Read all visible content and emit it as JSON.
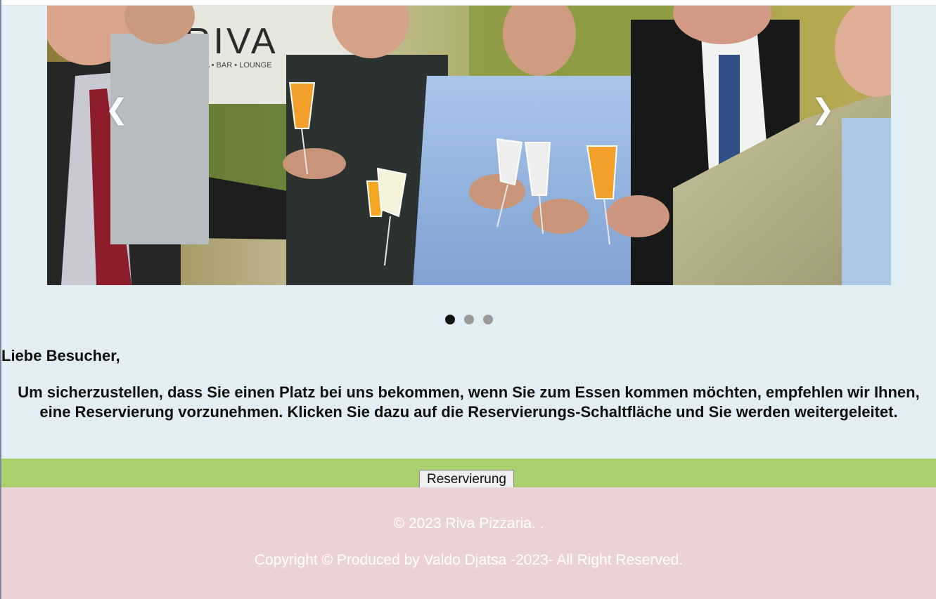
{
  "slideshow": {
    "prev_arrow": "❮",
    "next_arrow": "❯",
    "dots": [
      true,
      false,
      false
    ],
    "sign_text": "RIVA",
    "sign_subtext": "PIZZA • BAR • LOUNGE"
  },
  "content": {
    "greeting": "Liebe Besucher,",
    "intro": "Um sicherzustellen, dass Sie einen Platz bei uns bekommen, wenn Sie zum Essen kommen möchten, empfehlen wir Ihnen, eine Reservierung vorzunehmen. Klicken Sie dazu auf die Reservierungs-Schaltfläche und Sie werden weitergeleitet."
  },
  "reservation": {
    "button_label": "Reservierung"
  },
  "footer": {
    "copyright": "© 2023 Riva Pizzaria. .",
    "produced_by": "Copyright © Produced by Valdo Djatsa -2023- All Right Reserved."
  },
  "colors": {
    "page_bg": "#e2eef6",
    "reserve_bar": "#aacf6e",
    "footer_bg": "#ebd3d5",
    "active_dot": "#111111",
    "inactive_dot": "#9a9a9a"
  }
}
